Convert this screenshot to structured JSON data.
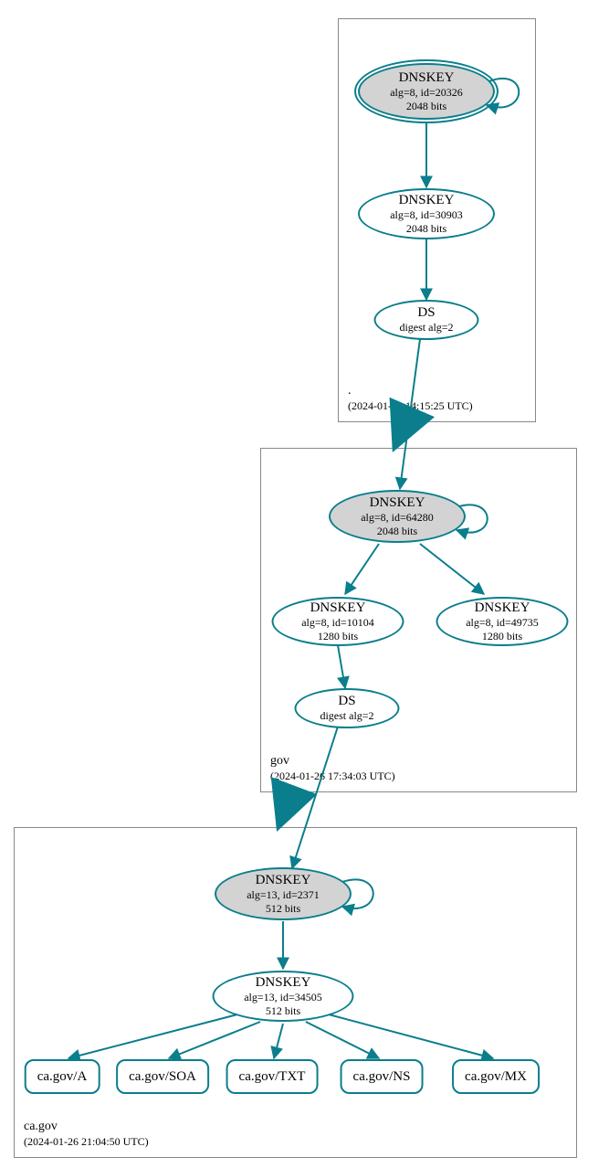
{
  "zones": {
    "root": {
      "name": ".",
      "timestamp": "(2024-01-26 14:15:25 UTC)"
    },
    "gov": {
      "name": "gov",
      "timestamp": "(2024-01-26 17:34:03 UTC)"
    },
    "cagov": {
      "name": "ca.gov",
      "timestamp": "(2024-01-26 21:04:50 UTC)"
    }
  },
  "nodes": {
    "root_ksk": {
      "title": "DNSKEY",
      "line2": "alg=8, id=20326",
      "line3": "2048 bits"
    },
    "root_zsk": {
      "title": "DNSKEY",
      "line2": "alg=8, id=30903",
      "line3": "2048 bits"
    },
    "root_ds": {
      "title": "DS",
      "line2": "digest alg=2"
    },
    "gov_ksk": {
      "title": "DNSKEY",
      "line2": "alg=8, id=64280",
      "line3": "2048 bits"
    },
    "gov_zsk1": {
      "title": "DNSKEY",
      "line2": "alg=8, id=10104",
      "line3": "1280 bits"
    },
    "gov_zsk2": {
      "title": "DNSKEY",
      "line2": "alg=8, id=49735",
      "line3": "1280 bits"
    },
    "gov_ds": {
      "title": "DS",
      "line2": "digest alg=2"
    },
    "cagov_ksk": {
      "title": "DNSKEY",
      "line2": "alg=13, id=2371",
      "line3": "512 bits"
    },
    "cagov_zsk": {
      "title": "DNSKEY",
      "line2": "alg=13, id=34505",
      "line3": "512 bits"
    },
    "rr_a": "ca.gov/A",
    "rr_soa": "ca.gov/SOA",
    "rr_txt": "ca.gov/TXT",
    "rr_ns": "ca.gov/NS",
    "rr_mx": "ca.gov/MX"
  }
}
